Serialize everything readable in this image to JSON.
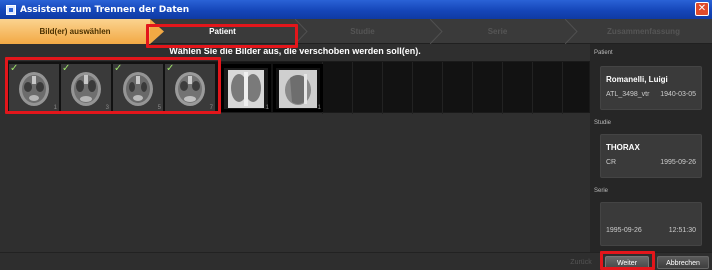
{
  "window": {
    "title": "Assistent zum Trennen der Daten",
    "close_glyph": "✕"
  },
  "steps": [
    {
      "label": "Bild(er) auswählen",
      "state": "done"
    },
    {
      "label": "Patient",
      "state": "current"
    },
    {
      "label": "Studie",
      "state": "disabled"
    },
    {
      "label": "Serie",
      "state": "disabled"
    },
    {
      "label": "Zusammenfassung",
      "state": "disabled"
    }
  ],
  "main": {
    "instruction": "Wählen Sie die Bilder aus, die verschoben werden soll(en).",
    "thumbnails": [
      {
        "kind": "ct-head",
        "selected": true,
        "number": "1"
      },
      {
        "kind": "ct-head",
        "selected": true,
        "number": "3"
      },
      {
        "kind": "ct-head",
        "selected": true,
        "number": "5"
      },
      {
        "kind": "ct-head",
        "selected": true,
        "number": "7"
      },
      {
        "kind": "xray-chest",
        "selected": false,
        "number": "1"
      },
      {
        "kind": "xray-chest-lateral",
        "selected": false,
        "number": "1"
      }
    ]
  },
  "right_panel": {
    "patient_label": "Patient",
    "patient_name": "Romanelli, Luigi",
    "patient_id": "ATL_3498_vtr",
    "patient_dob": "1940-03-05",
    "study_label": "Studie",
    "study_name": "THORAX",
    "study_modality": "CR",
    "study_date": "1995-09-26",
    "series_label": "Serie",
    "series_date": "1995-09-26",
    "series_time": "12:51:30"
  },
  "buttons": {
    "back": "Zurück",
    "next": "Weiter",
    "cancel": "Abbrechen"
  },
  "colors": {
    "accent": "#f2a944",
    "highlight": "#e3161b",
    "titlebar": "#1546b9"
  },
  "icons": {
    "check": "✓"
  }
}
